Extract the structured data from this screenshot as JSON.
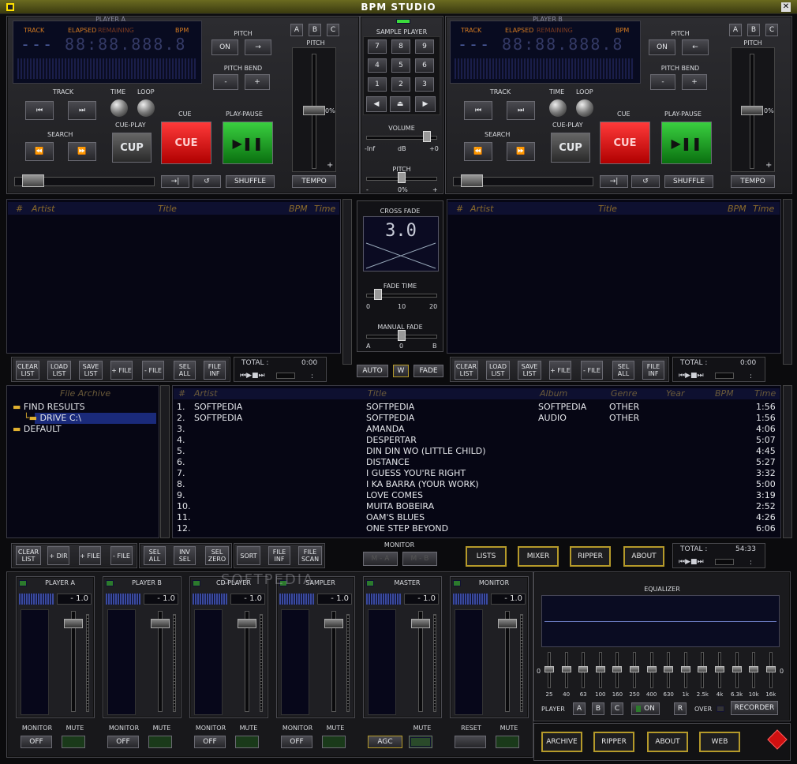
{
  "title": "BPM STUDIO",
  "playerA": {
    "name": "PLAYER A",
    "track": "TRACK",
    "elapsed": "ELAPSED",
    "remaining": "REMAINING",
    "bpm": "BPM",
    "pitch": "PITCH",
    "on": "ON",
    "pitch_bend": "PITCH BEND",
    "pitch_label": "PITCH",
    "zero": "0%",
    "plus": "+",
    "minus": "-",
    "track_lbl": "TRACK",
    "time": "TIME",
    "loop": "LOOP",
    "cue": "CUE",
    "play_pause": "PLAY-PAUSE",
    "cue_play": "CUE-PLAY",
    "search": "SEARCH",
    "cup": "CUP",
    "cue_btn": "CUE",
    "shuffle": "SHUFFLE",
    "tempo": "TEMPO",
    "a": "A",
    "b": "B",
    "c": "C"
  },
  "playerB": {
    "name": "PLAYER B",
    "track": "TRACK",
    "elapsed": "ELAPSED",
    "remaining": "REMAINING",
    "bpm": "BPM",
    "pitch": "PITCH",
    "on": "ON",
    "pitch_bend": "PITCH BEND",
    "pitch_label": "PITCH",
    "zero": "0%",
    "plus": "+",
    "minus": "-",
    "track_lbl": "TRACK",
    "time": "TIME",
    "loop": "LOOP",
    "cue": "CUE",
    "play_pause": "PLAY-PAUSE",
    "cue_play": "CUE-PLAY",
    "search": "SEARCH",
    "cup": "CUP",
    "cue_btn": "CUE",
    "shuffle": "SHUFFLE",
    "tempo": "TEMPO",
    "a": "A",
    "b": "B",
    "c": "C"
  },
  "sampler": {
    "title": "SAMPLE PLAYER",
    "keys": [
      "7",
      "8",
      "9",
      "4",
      "5",
      "6",
      "1",
      "2",
      "3"
    ],
    "volume": "VOLUME",
    "vol_min": "-Inf",
    "vol_db": "dB",
    "vol_max": "+0",
    "pitch": "PITCH",
    "pitch_min": "-",
    "pitch_zero": "0%",
    "pitch_plus": "+"
  },
  "crossfade": {
    "title": "CROSS FADE",
    "value": "3.0",
    "fade_time": "FADE TIME",
    "ft0": "0",
    "ft10": "10",
    "ft20": "20",
    "manual": "MANUAL FADE",
    "mA": "A",
    "m0": "0",
    "mB": "B",
    "auto": "AUTO",
    "w": "W",
    "fade": "FADE"
  },
  "playlist": {
    "num": "#",
    "artist": "Artist",
    "title": "Title",
    "bpm": "BPM",
    "time": "Time"
  },
  "listButtons": {
    "clear": "CLEAR LIST",
    "load": "LOAD LIST",
    "save": "SAVE LIST",
    "addfile": "+ FILE",
    "remfile": "- FILE",
    "selall": "SEL ALL",
    "fileinf": "FILE INF",
    "total": "TOTAL :",
    "total_val": "0:00",
    "colon": ":"
  },
  "archive": {
    "title": "File Archive",
    "items": [
      "FIND RESULTS",
      "DRIVE C:\\",
      "DEFAULT"
    ]
  },
  "library": {
    "cols": [
      "#",
      "Artist",
      "Title",
      "Album",
      "Genre",
      "Year",
      "BPM",
      "Time"
    ],
    "rows": [
      [
        "1.",
        "SOFTPEDIA",
        "SOFTPEDIA",
        "SOFTPEDIA",
        "OTHER",
        "1:56"
      ],
      [
        "2.",
        "SOFTPEDIA",
        "SOFTPEDIA",
        "AUDIO",
        "OTHER",
        "1:56"
      ],
      [
        "3.",
        "",
        "AMANDA",
        "",
        "",
        "4:06"
      ],
      [
        "4.",
        "",
        "DESPERTAR",
        "",
        "",
        "5:07"
      ],
      [
        "5.",
        "",
        "DIN DIN WO (LITTLE CHILD)",
        "",
        "",
        "4:45"
      ],
      [
        "6.",
        "",
        "DISTANCE",
        "",
        "",
        "5:27"
      ],
      [
        "7.",
        "",
        "I GUESS YOU'RE RIGHT",
        "",
        "",
        "3:32"
      ],
      [
        "8.",
        "",
        "I KA BARRA (YOUR WORK)",
        "",
        "",
        "5:00"
      ],
      [
        "9.",
        "",
        "LOVE COMES",
        "",
        "",
        "3:19"
      ],
      [
        "10.",
        "",
        "MUITA BOBEIRA",
        "",
        "",
        "2:52"
      ],
      [
        "11.",
        "",
        "OAM'S BLUES",
        "",
        "",
        "4:26"
      ],
      [
        "12.",
        "",
        "ONE STEP BEYOND",
        "",
        "",
        "6:06"
      ]
    ]
  },
  "bottomButtons": {
    "clear": "CLEAR LIST",
    "adddir": "+ DIR",
    "addfile": "+ FILE",
    "remfile": "- FILE",
    "selall": "SEL ALL",
    "invsel": "INV SEL",
    "selzero": "SEL ZERO",
    "sort": "SORT",
    "fileinf": "FILE INF",
    "filescan": "FILE SCAN",
    "monitor": "MONITOR",
    "ma": "M - A",
    "mb": "M - B",
    "lists": "LISTS",
    "mixer": "MIXER",
    "ripper": "RIPPER",
    "about": "ABOUT",
    "total": "TOTAL :",
    "total_val": "54:33",
    "colon": ":"
  },
  "mixer": {
    "channels": [
      "PLAYER A",
      "PLAYER B",
      "CD PLAYER",
      "SAMPLER",
      "MASTER",
      "MONITOR"
    ],
    "db": "- 1.0",
    "monitor": "MONITOR",
    "mute": "MUTE",
    "off": "OFF",
    "agc": "AGC",
    "reset": "RESET"
  },
  "eq": {
    "title": "EQUALIZER",
    "zero": "0",
    "bands": [
      "25",
      "40",
      "63",
      "100",
      "160",
      "250",
      "400",
      "630",
      "1k",
      "2.5k",
      "4k",
      "6.3k",
      "10k",
      "16k"
    ],
    "player": "PLAYER",
    "a": "A",
    "b": "B",
    "c": "C",
    "on": "ON",
    "r": "R",
    "over": "OVER",
    "recorder": "RECORDER"
  },
  "footer": {
    "archive": "ARCHIVE",
    "ripper": "RIPPER",
    "about": "ABOUT",
    "web": "WEB"
  },
  "watermark": "SOFTPEDIA"
}
